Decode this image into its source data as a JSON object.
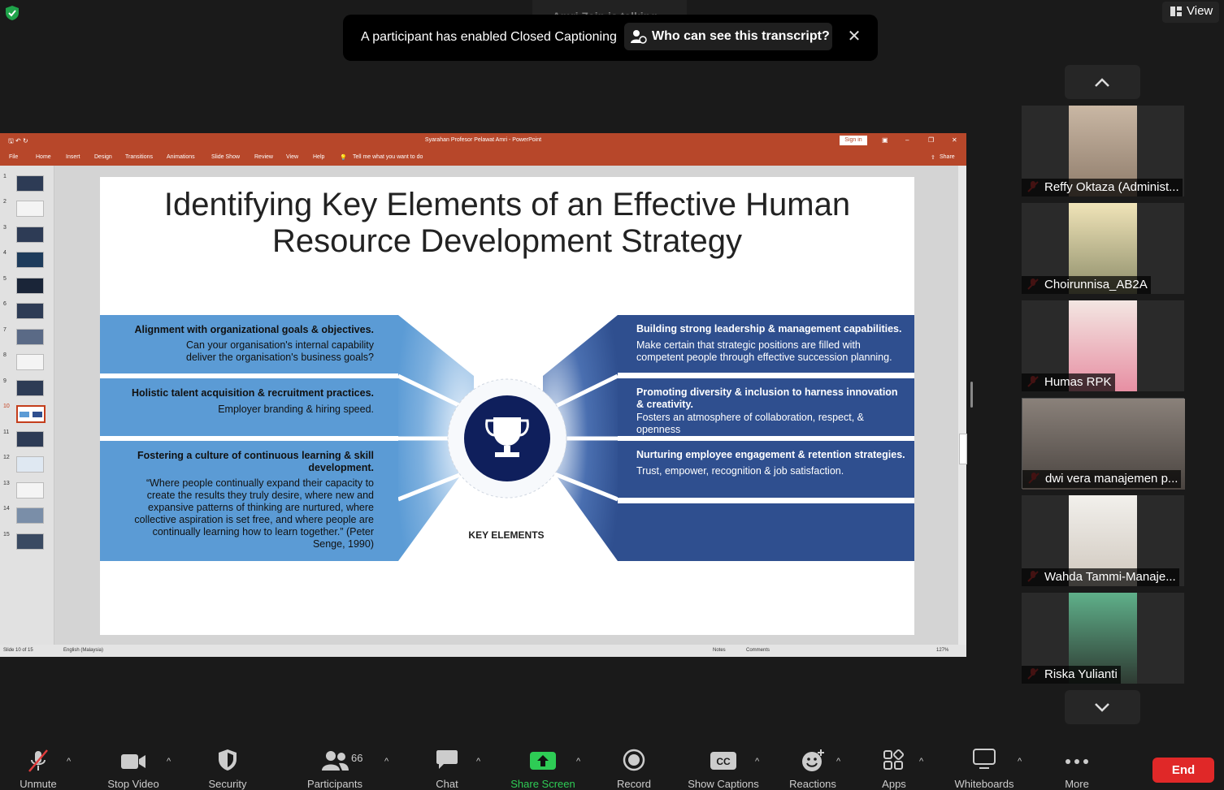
{
  "top": {
    "talking": "Amri Zain is talking...",
    "cc_message": "A participant has enabled Closed Captioning",
    "cc_button": "Who can see this transcript?",
    "view_label": "View"
  },
  "ppt": {
    "window_title": "Syarahan Profesor Pelawat Amri  -  PowerPoint",
    "sign_in": "Sign in",
    "share": "Share",
    "tabs": [
      "File",
      "Home",
      "Insert",
      "Design",
      "Transitions",
      "Animations",
      "Slide Show",
      "Review",
      "View",
      "Help"
    ],
    "tell_me": "Tell me what you want to do",
    "slide_numbers": [
      "1",
      "2",
      "3",
      "4",
      "5",
      "6",
      "7",
      "8",
      "9",
      "10",
      "11",
      "12",
      "13",
      "14",
      "15"
    ],
    "status_slide": "Slide 10 of 15",
    "status_lang": "English (Malaysia)",
    "status_notes": "Notes",
    "status_comments": "Comments",
    "status_zoom": "127%"
  },
  "slide": {
    "title_line1": "Identifying Key Elements of an Effective Human",
    "title_line2": "Resource Development Strategy",
    "left": [
      {
        "head": "Alignment with organizational goals & objectives.",
        "body1": "Can your organisation's internal capability",
        "body2": "deliver the organisation's business goals?"
      },
      {
        "head": "Holistic talent acquisition & recruitment practices.",
        "body1": "Employer branding & hiring speed."
      },
      {
        "head1": "Fostering a culture of continuous learning & skill",
        "head2": "development.",
        "body": [
          "“Where people continually expand their capacity to",
          "create the results they truly desire, where new and",
          "expansive patterns of thinking are nurtured, where",
          "collective aspiration is set free, and where people are",
          "continually learning how to learn together.” (Peter",
          "Senge, 1990)"
        ]
      }
    ],
    "right": [
      {
        "head": "Building strong leadership & management capabilities.",
        "body1": "Make certain that strategic positions are filled with",
        "body2": "competent people through effective succession planning."
      },
      {
        "head1": "Promoting diversity & inclusion to harness innovation",
        "head2": "& creativity.",
        "body1": "Fosters an atmosphere of collaboration, respect, &",
        "body2": "openness"
      },
      {
        "head": "Nurturing employee engagement & retention strategies.",
        "body1": "Trust, empower, recognition & job satisfaction."
      }
    ],
    "center_label": "KEY ELEMENTS"
  },
  "participants": [
    {
      "name": "Reffy Oktaza (Administ...",
      "color": "#c9b7a4"
    },
    {
      "name": "Choirunnisa_AB2A",
      "color": "#d7c68a"
    },
    {
      "name": "Humas RPK",
      "color": "#e78fa3"
    },
    {
      "name": "dwi vera manajemen p...",
      "color": "#6b6560"
    },
    {
      "name": "Wahda Tammi-Manaje...",
      "color": "#e4e0da"
    },
    {
      "name": "Riska Yulianti",
      "color": "#4f8f6f"
    }
  ],
  "toolbar": {
    "unmute": "Unmute",
    "stop_video": "Stop Video",
    "security": "Security",
    "participants": "Participants",
    "participants_count": "66",
    "chat": "Chat",
    "share_screen": "Share Screen",
    "record": "Record",
    "show_captions": "Show Captions",
    "reactions": "Reactions",
    "apps": "Apps",
    "whiteboards": "Whiteboards",
    "more": "More",
    "end": "End"
  },
  "colors": {
    "ppt_accent": "#b7472a",
    "share_green": "#2ecc55",
    "end_red": "#e02828",
    "slide_light_blue": "#5b9bd5",
    "slide_dark_blue": "#2f4f8f",
    "trophy_navy": "#0f1f5c"
  }
}
